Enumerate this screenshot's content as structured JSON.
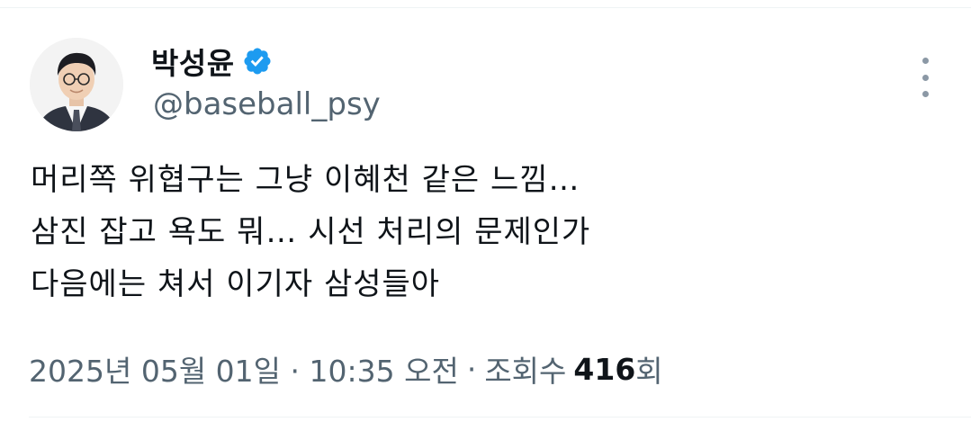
{
  "author": {
    "display_name": "박성윤",
    "handle": "@baseball_psy",
    "verified": true
  },
  "tweet": {
    "lines": [
      "머리쪽 위협구는 그냥 이혜천 같은 느낌…",
      "삼진 잡고 욕도 뭐… 시선 처리의 문제인가",
      "다음에는 쳐서 이기자 삼성들아"
    ],
    "datetime": "2025년 05월 01일 · 10:35 오전",
    "separator": "·",
    "views_label_prefix": "조회수",
    "views_count": "416",
    "views_label_suffix": "회"
  },
  "icons": {
    "verified_badge": "verified-badge-icon",
    "more": "more-options-icon"
  },
  "colors": {
    "verified": "#1d9bf0",
    "secondary_text": "#536471",
    "primary_text": "#0f1419"
  }
}
